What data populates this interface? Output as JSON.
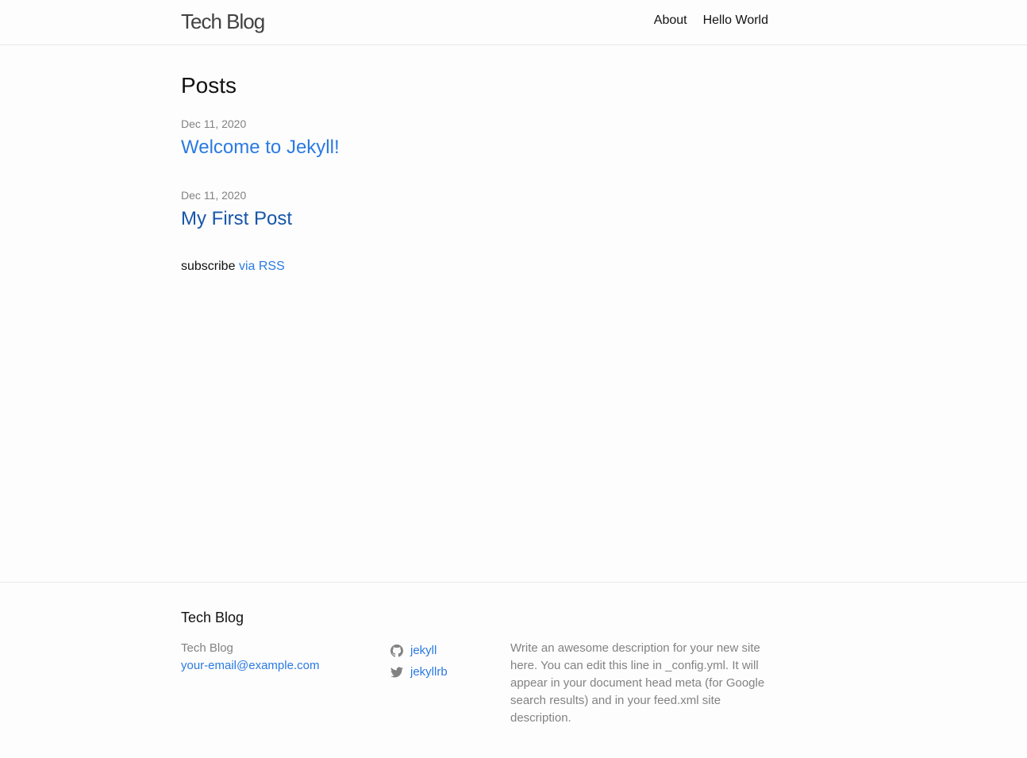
{
  "header": {
    "site_title": "Tech Blog",
    "nav": [
      {
        "label": "About"
      },
      {
        "label": "Hello World"
      }
    ]
  },
  "main": {
    "heading": "Posts",
    "posts": [
      {
        "date": "Dec 11, 2020",
        "title": "Welcome to Jekyll!"
      },
      {
        "date": "Dec 11, 2020",
        "title": "My First Post"
      }
    ],
    "subscribe_text": "subscribe",
    "rss_link": "via RSS"
  },
  "footer": {
    "heading": "Tech Blog",
    "name": "Tech Blog",
    "email": "your-email@example.com",
    "social": [
      {
        "icon": "github-icon",
        "username": "jekyll"
      },
      {
        "icon": "twitter-icon",
        "username": "jekyllrb"
      }
    ],
    "description": "Write an awesome description for your new site here. You can edit this line in _config.yml. It will appear in your document head meta (for Google search results) and in your feed.xml site description."
  },
  "colors": {
    "link": "#2a7ae2",
    "visited_link": "#1756a9",
    "meta_gray": "#828282",
    "text": "#111111",
    "border": "#e8e8e8"
  }
}
